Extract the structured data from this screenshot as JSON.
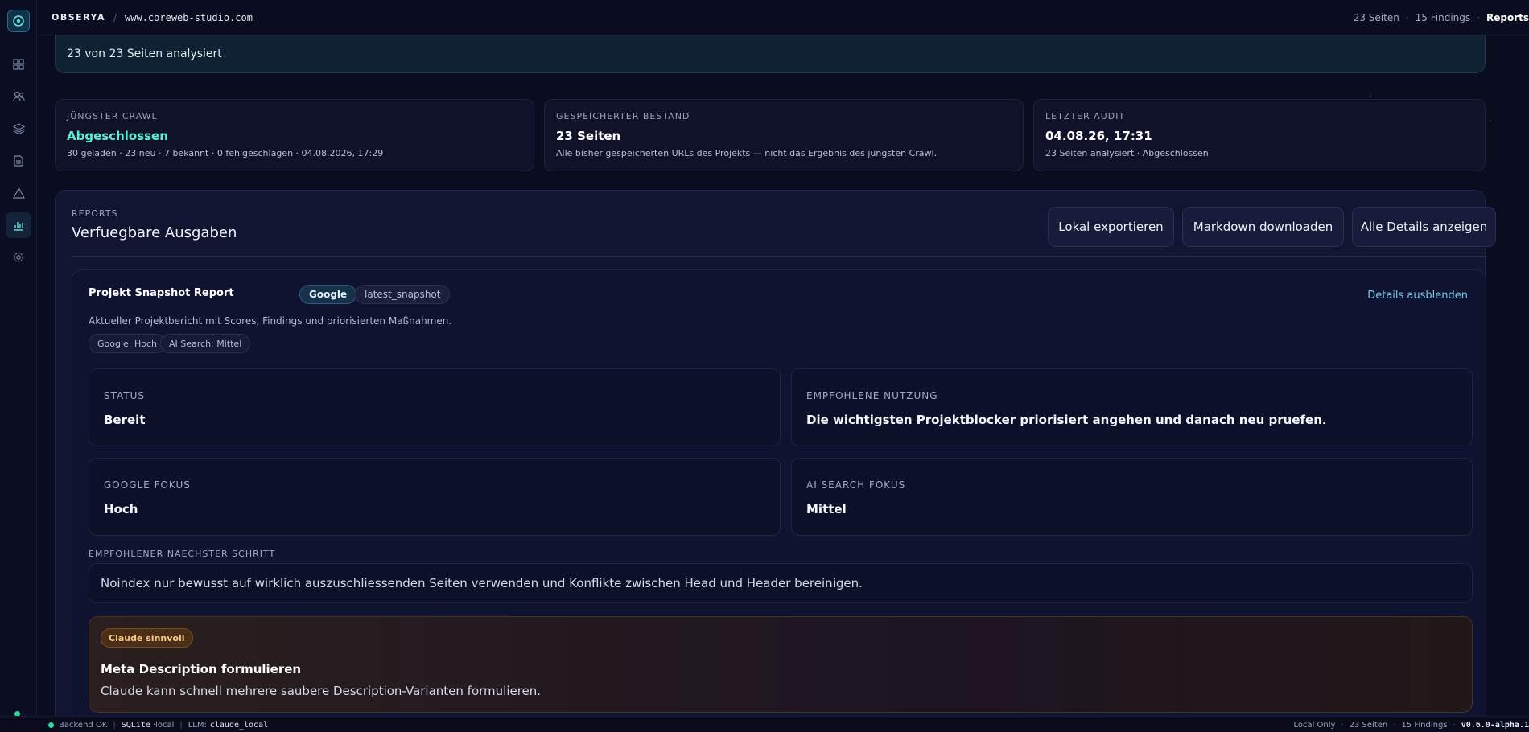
{
  "app": {
    "brand": "OBSERYA",
    "domain": "www.coreweb-studio.com"
  },
  "topbar": {
    "pages": "23 Seiten",
    "findings": "15 Findings",
    "section": "Reports"
  },
  "banner": {
    "text": "23 von 23 Seiten analysiert"
  },
  "stats": [
    {
      "label": "JÜNGSTER CRAWL",
      "value": "Abgeschlossen",
      "sub": "30 geladen · 23 neu · 7 bekannt · 0 fehlgeschlagen · 04.08.2026, 17:29"
    },
    {
      "label": "GESPEICHERTER BESTAND",
      "value": "23 Seiten",
      "sub": "Alle bisher gespeicherten URLs des Projekts — nicht das Ergebnis des jüngsten Crawl."
    },
    {
      "label": "LETZTER AUDIT",
      "value": "04.08.26, 17:31",
      "sub": "23 Seiten analysiert · Abgeschlossen"
    }
  ],
  "reports": {
    "label": "REPORTS",
    "title": "Verfuegbare Ausgaben",
    "buttons": {
      "export": "Lokal exportieren",
      "markdown": "Markdown downloaden",
      "details": "Alle Details anzeigen"
    }
  },
  "card": {
    "title": "Projekt Snapshot Report",
    "tag_google": "Google",
    "tag_snapshot": "latest_snapshot",
    "details_link": "Details ausblenden",
    "description": "Aktueller Projektbericht mit Scores, Findings und priorisierten Maßnahmen.",
    "chips": [
      "Google: Hoch",
      "AI Search: Mittel"
    ],
    "info": [
      {
        "label": "STATUS",
        "value": "Bereit"
      },
      {
        "label": "EMPFOHLENE NUTZUNG",
        "value": "Die wichtigsten Projektblocker priorisiert angehen und danach neu pruefen."
      },
      {
        "label": "GOOGLE FOKUS",
        "value": "Hoch"
      },
      {
        "label": "AI SEARCH FOKUS",
        "value": "Mittel"
      }
    ],
    "next_step_label": "EMPFOHLENER NAECHSTER SCHRITT",
    "next_step": "Noindex nur bewusst auf wirklich auszuschliessenden Seiten verwenden und Konflikte zwischen Head und Header bereinigen.",
    "claude": {
      "tag": "Claude sinnvoll",
      "title": "Meta Description formulieren",
      "text": "Claude kann schnell mehrere saubere Description-Varianten formulieren."
    }
  },
  "statusbar": {
    "backend": "Backend OK",
    "db": "SQLite",
    "db_mode": "·local",
    "llm_label": "LLM:",
    "llm": "claude_local",
    "mode": "Local Only",
    "pages": "23 Seiten",
    "findings": "15 Findings",
    "version": "v0.6.0-alpha.1"
  },
  "icons": [
    "target-icon",
    "grid-icon",
    "users-icon",
    "layers-icon",
    "document-icon",
    "warning-icon",
    "chart-icon",
    "gear-icon"
  ],
  "colors": {
    "accent": "#5eead4",
    "link": "#74c9e5",
    "ok": "#34d399",
    "claude": "#f7c98e"
  }
}
